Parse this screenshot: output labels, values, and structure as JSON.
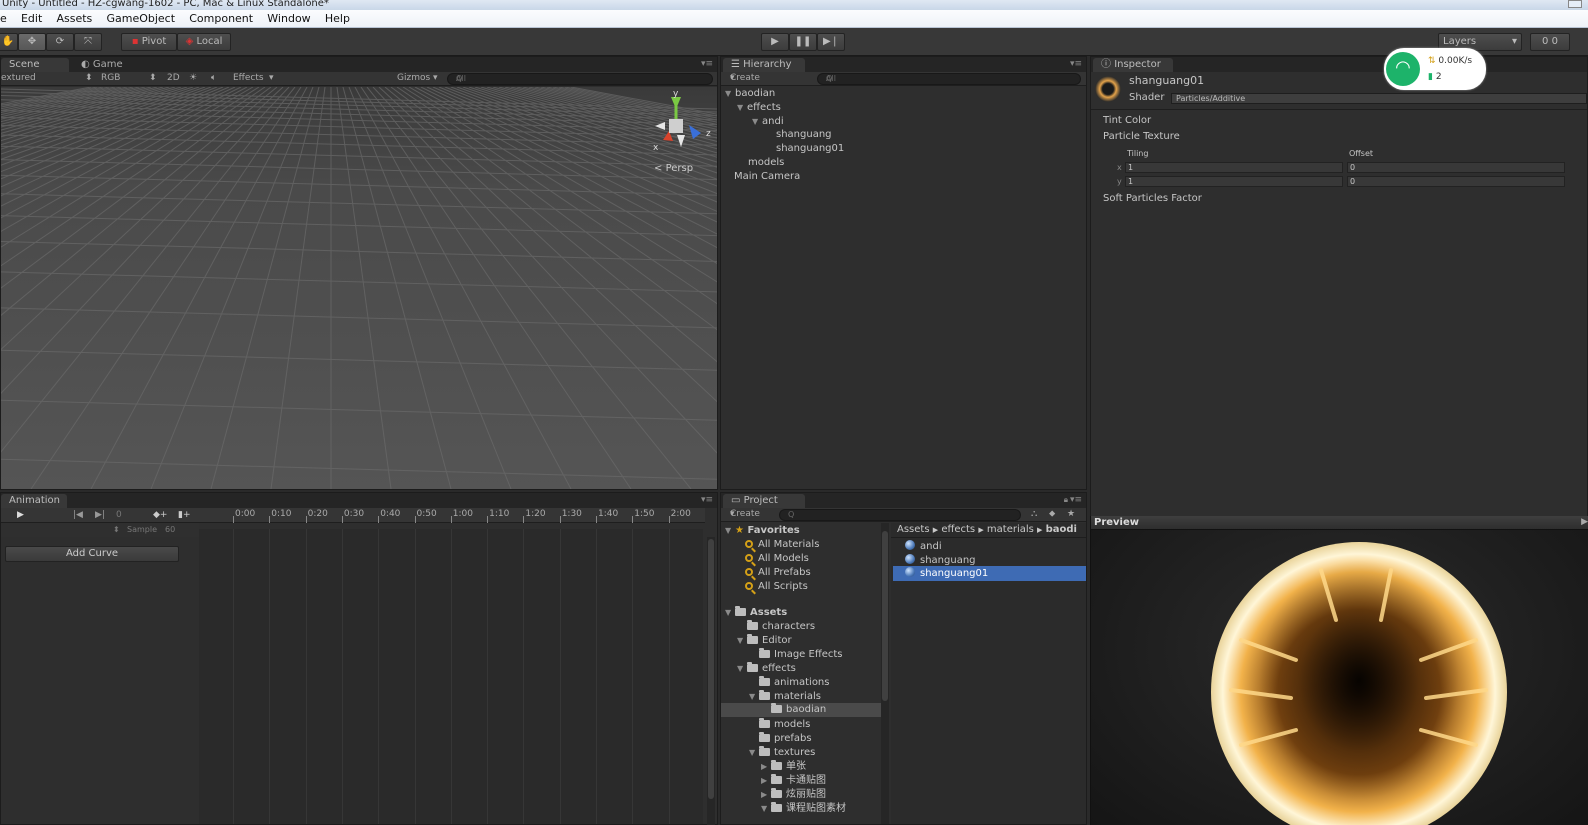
{
  "titlebar": {
    "title": "Unity - Untitled - HZ-cgwang-1602 - PC, Mac & Linux Standalone*"
  },
  "menu": [
    "e",
    "Edit",
    "Assets",
    "GameObject",
    "Component",
    "Window",
    "Help"
  ],
  "toolbar": {
    "pivot_label": "Pivot",
    "local_label": "Local",
    "layers_label": "Layers",
    "layout_label": "0 0"
  },
  "scene": {
    "tab_scene": "Scene",
    "tab_game": "Game",
    "shading": "extured",
    "rgb": "RGB",
    "mode_2d": "2D",
    "effects": "Effects",
    "gizmos": "Gizmos",
    "search_placeholder": "All",
    "axis_y": "y",
    "axis_z": "z",
    "axis_x": "x",
    "persp": "Persp"
  },
  "hierarchy": {
    "tab": "Hierarchy",
    "create": "Create",
    "search_placeholder": "All",
    "items": [
      "baodian",
      "effects",
      "andi",
      "shanguang",
      "shanguang01",
      "models",
      "Main Camera"
    ]
  },
  "inspector": {
    "tab": "Inspector",
    "object_name": "shanguang01",
    "shader_label": "Shader",
    "shader_value": "Particles/Additive",
    "tint_color": "Tint Color",
    "particle_texture": "Particle Texture",
    "tiling": "Tiling",
    "offset": "Offset",
    "x_label": "x",
    "y_label": "y",
    "tiling_x": "1",
    "tiling_y": "1",
    "offset_x": "0",
    "offset_y": "0",
    "soft_particles": "Soft Particles Factor",
    "preview": "Preview"
  },
  "network": {
    "speed": "0.00K/s",
    "count": "2"
  },
  "animation": {
    "tab": "Animation",
    "frame": "0",
    "sample_label": "Sample",
    "sample_value": "60",
    "add_curve": "Add Curve",
    "ticks": [
      "0:00",
      "0:10",
      "0:20",
      "0:30",
      "0:40",
      "0:50",
      "1:00",
      "1:10",
      "1:20",
      "1:30",
      "1:40",
      "1:50",
      "2:00"
    ]
  },
  "project": {
    "tab": "Project",
    "create": "Create",
    "favorites_label": "Favorites",
    "favorites": [
      "All Materials",
      "All Models",
      "All Prefabs",
      "All Scripts"
    ],
    "assets_label": "Assets",
    "tree": [
      "characters",
      "Editor",
      "Image Effects",
      "effects",
      "animations",
      "materials",
      "baodian",
      "models",
      "prefabs",
      "textures",
      "单张",
      "卡通贴图",
      "炫丽贴图",
      "课程贴图素材"
    ],
    "breadcrumb": [
      "Assets",
      "effects",
      "materials",
      "baodi"
    ],
    "files": [
      "andi",
      "shanguang",
      "shanguang01"
    ]
  }
}
